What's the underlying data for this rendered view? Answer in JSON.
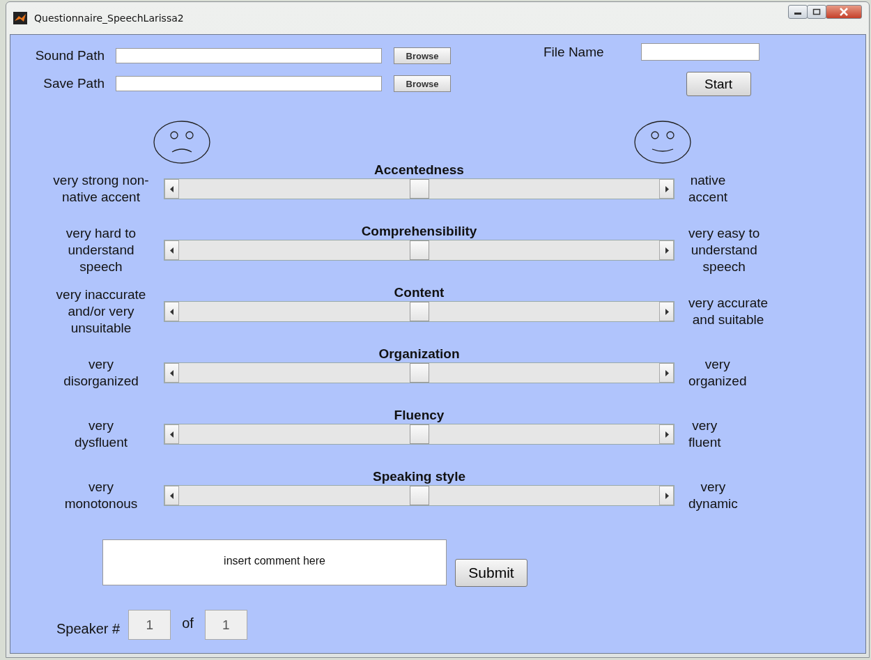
{
  "window": {
    "title": "Questionnaire_SpeechLarissa2"
  },
  "paths": [
    {
      "label": "Sound Path",
      "button": "Browse"
    },
    {
      "label": "Save Path",
      "button": "Browse"
    }
  ],
  "file_name": {
    "label": "File Name"
  },
  "start_button": "Start",
  "scales": [
    {
      "title": "Accentedness",
      "left": "very strong non-\nnative accent",
      "right": "native\naccent",
      "level": 0.5
    },
    {
      "title": "Comprehensibility",
      "left": "very hard to\nunderstand\nspeech",
      "right": "very easy to\nunderstand\nspeech",
      "level": 0.5
    },
    {
      "title": "Content",
      "left": "very inaccurate\nand/or very\nunsuitable",
      "right": "very accurate\nand suitable",
      "level": 0.5
    },
    {
      "title": "Organization",
      "left": "very\ndisorganized",
      "right": "very\norganized",
      "level": 0.5
    },
    {
      "title": "Fluency",
      "left": "very\ndysfluent",
      "right": "very\nfluent",
      "level": 0.5
    },
    {
      "title": "Speaking style",
      "left": "very\nmonotonous",
      "right": "very\ndynamic",
      "level": 0.5
    }
  ],
  "comment": {
    "value": "insert comment here"
  },
  "submit_button": "Submit",
  "speaker": {
    "label": "Speaker #",
    "value": "1",
    "of": "of",
    "total": "1",
    "disabled": true
  }
}
